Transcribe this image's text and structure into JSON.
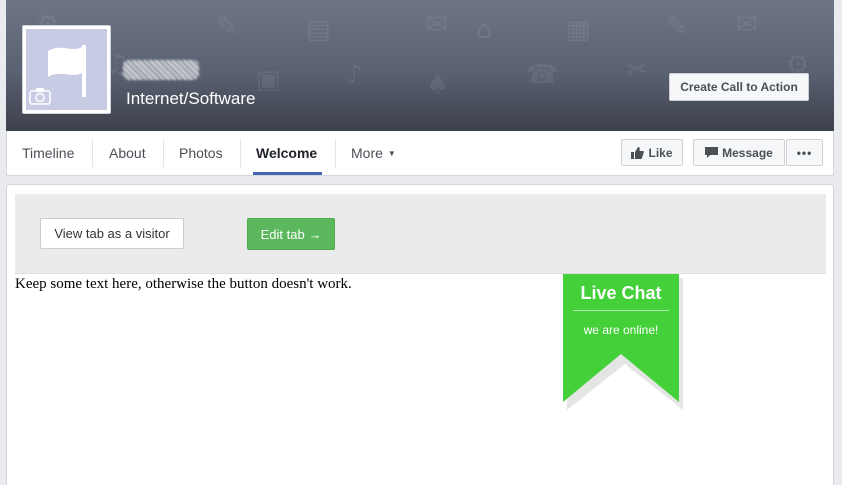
{
  "header": {
    "category": "Internet/Software",
    "cta_label": "Create Call to Action"
  },
  "nav": {
    "tabs": [
      {
        "label": "Timeline"
      },
      {
        "label": "About"
      },
      {
        "label": "Photos"
      },
      {
        "label": "Welcome",
        "active": true
      },
      {
        "label": "More"
      }
    ],
    "like_label": "Like",
    "message_label": "Message",
    "more_actions_label": "•••"
  },
  "admin": {
    "visitor_label": "View tab as a visitor",
    "edit_label": "Edit tab →"
  },
  "content": {
    "text": "Keep some text here, otherwise the button doesn't work."
  },
  "live_chat": {
    "title": "Live Chat",
    "subtitle": "we are online!",
    "color": "#44d039",
    "shadow_color": "#e4e6e4"
  },
  "colors": {
    "active_tab_underline": "#4267b2",
    "edit_button": "#5cb85c"
  }
}
